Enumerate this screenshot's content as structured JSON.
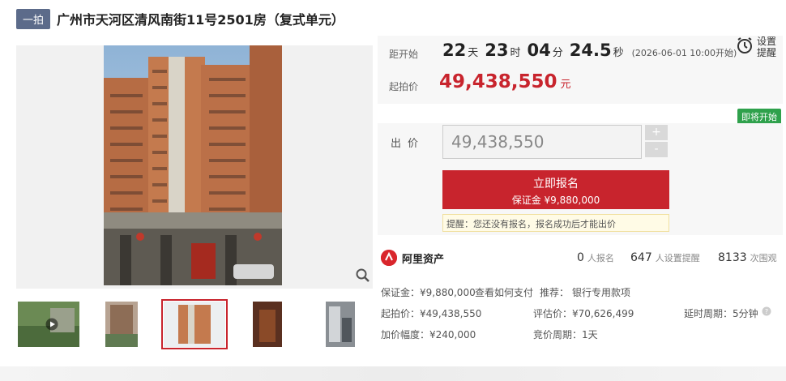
{
  "header": {
    "badge": "一拍",
    "title": "广州市天河区清风南街11号2501房（复式单元）"
  },
  "countdown": {
    "label": "距开始",
    "days": "22",
    "days_unit": "天",
    "hours": "23",
    "hours_unit": "时",
    "minutes": "04",
    "minutes_unit": "分",
    "seconds": "24.5",
    "seconds_unit": "秒",
    "start_time": "(2026-06-01 10:00开始)"
  },
  "remind": {
    "label": "设置提醒",
    "icon": "alarm-clock-icon"
  },
  "start_price": {
    "label": "起拍价",
    "value": "49,438,550",
    "unit": "元"
  },
  "status_tag": "即将开始",
  "bid": {
    "label": "出价",
    "input_value": "49,438,550",
    "plus": "+",
    "minus": "-",
    "signup_label": "立即报名",
    "deposit_line": "保证金 ¥9,880,000",
    "tip": "提醒：您还没有报名，报名成功后才能出价"
  },
  "platform": {
    "name": "阿里资产",
    "signups": {
      "num": "0",
      "label": "人报名"
    },
    "reminders": {
      "num": "647",
      "label": "人设置提醒"
    },
    "views": {
      "num": "8133",
      "label": "次围观"
    }
  },
  "details": {
    "deposit": "保证金：¥9,880,000",
    "how_to_pay": "查看如何支付",
    "recommend_label": "推荐：",
    "recommend_link": "银行专用款项",
    "start_price": "起拍价：¥49,438,550",
    "appraisal": "评估价：¥70,626,499",
    "delay_period": "延时周期：5分钟",
    "increment": "加价幅度：¥240,000",
    "bid_cycle": "竞价周期：1天"
  },
  "colors": {
    "accent_red": "#c8242d",
    "status_green": "#2fa14c",
    "link_blue": "#3a6fc4",
    "badge_gray": "#5c6b8a"
  }
}
